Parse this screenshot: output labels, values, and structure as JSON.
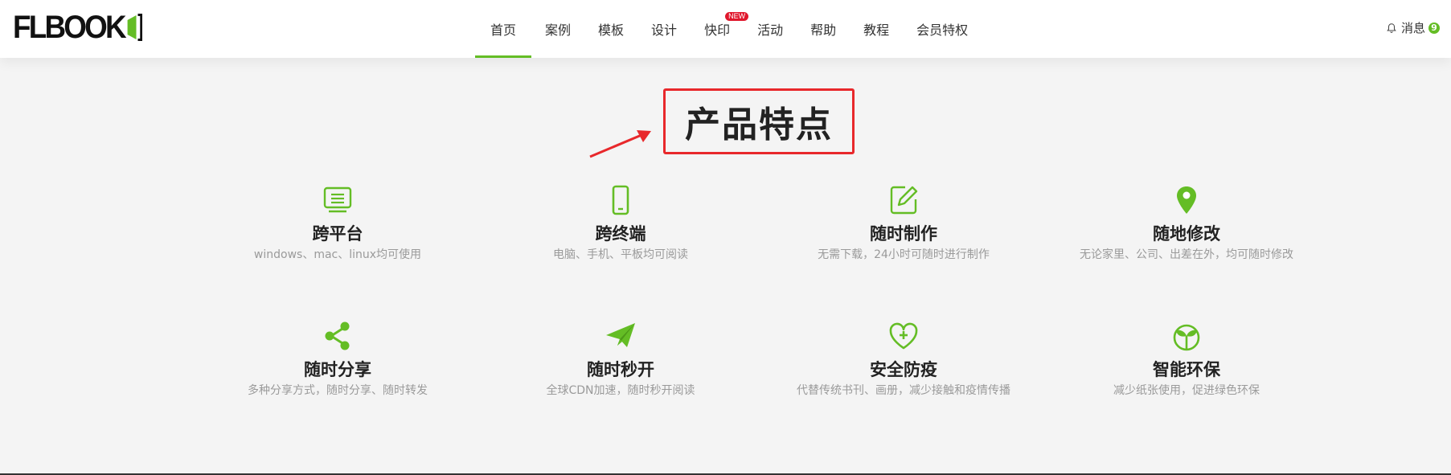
{
  "header": {
    "logo_text": "FLBOOK",
    "nav": [
      {
        "label": "首页",
        "active": true
      },
      {
        "label": "案例"
      },
      {
        "label": "模板"
      },
      {
        "label": "设计"
      },
      {
        "label": "快印",
        "badge": "NEW"
      },
      {
        "label": "活动"
      },
      {
        "label": "帮助"
      },
      {
        "label": "教程"
      },
      {
        "label": "会员特权"
      }
    ],
    "messages_label": "消息",
    "messages_count": "9"
  },
  "section": {
    "title": "产品特点"
  },
  "features": [
    {
      "title": "跨平台",
      "desc": "windows、mac、linux均可使用",
      "icon": "monitor-icon"
    },
    {
      "title": "跨终端",
      "desc": "电脑、手机、平板均可阅读",
      "icon": "phone-icon"
    },
    {
      "title": "随时制作",
      "desc": "无需下载，24小时可随时进行制作",
      "icon": "edit-icon"
    },
    {
      "title": "随地修改",
      "desc": "无论家里、公司、出差在外，均可随时修改",
      "icon": "location-icon"
    },
    {
      "title": "随时分享",
      "desc": "多种分享方式，随时分享、随时转发",
      "icon": "share-icon"
    },
    {
      "title": "随时秒开",
      "desc": "全球CDN加速，随时秒开阅读",
      "icon": "paper-plane-icon"
    },
    {
      "title": "安全防疫",
      "desc": "代替传统书刊、画册，减少接触和疫情传播",
      "icon": "heart-plus-icon"
    },
    {
      "title": "智能环保",
      "desc": "减少纸张使用，促进绿色环保",
      "icon": "sprout-icon"
    }
  ],
  "colors": {
    "accent": "#64bd25",
    "annotation": "#e8282b",
    "badge": "#e0182d"
  }
}
